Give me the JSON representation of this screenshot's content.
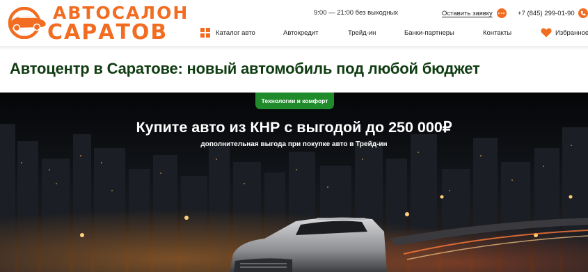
{
  "brand": {
    "name_line1": "АВТОСАЛОН",
    "name_line2": "САРАТОВ",
    "color": "#f26c21"
  },
  "header": {
    "hours": "9:00 — 21:00 без выходных",
    "request_label": "Оставить заявку",
    "request_icon": "chat-icon",
    "phone": "+7 (845) 299-01-90",
    "phone_icon": "phone-icon"
  },
  "nav": {
    "items": [
      {
        "label": "Каталог авто",
        "icon": "grid-icon"
      },
      {
        "label": "Автокредит"
      },
      {
        "label": "Трейд-ин"
      },
      {
        "label": "Банки-партнеры"
      },
      {
        "label": "Контакты"
      },
      {
        "label": "Избранное",
        "icon": "heart-icon"
      }
    ]
  },
  "page": {
    "title": "Автоцентр в Саратове: новый автомобиль под любой бюджет"
  },
  "hero": {
    "badge": "Технологии и комфорт",
    "title": "Купите авто из КНР с выгодой до 250 000₽",
    "subtitle": "дополнительная выгода при покупке авто в Трейд-ин",
    "badge_color": "#1f8b2a"
  }
}
